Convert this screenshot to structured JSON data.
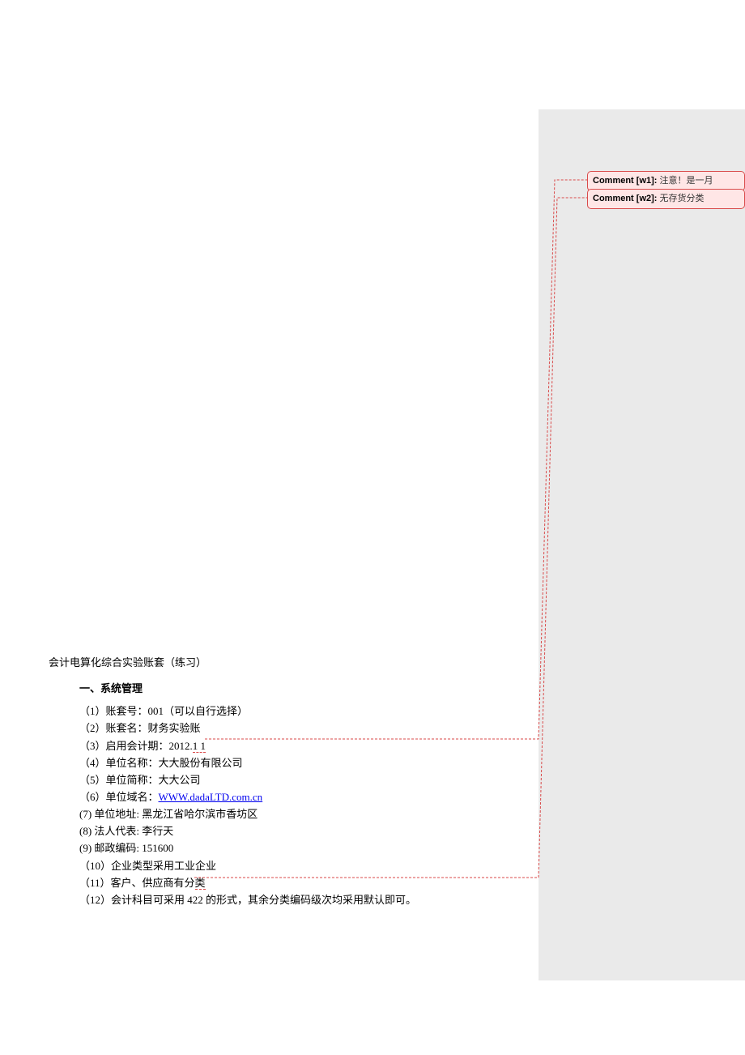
{
  "comments": [
    {
      "label": "Comment [w1]:",
      "text": "注意！是一月"
    },
    {
      "label": "Comment [w2]:",
      "text": "无存货分类"
    }
  ],
  "doc": {
    "title": "会计电算化综合实验账套（练习）",
    "section": "一、系统管理",
    "items": {
      "i1": "（1）账套号：001（可以自行选择）",
      "i2": "（2）账套名：财务实验账",
      "i3_pre": "（3）启用会计期：2012.",
      "i3_hl": "1 1",
      "i4": "（4）单位名称：大大股份有限公司",
      "i5": "（5）单位简称：大大公司",
      "i6_pre": "（6）单位域名：",
      "i6_link": "WWW.dadaLTD.com.cn",
      "i7": "(7)   单位地址: 黑龙江省哈尔滨市香坊区",
      "i8": "(8)   法人代表:  李行天",
      "i9": "(9)   邮政编码: 151600",
      "i10": "（10）企业类型采用工业企业",
      "i11_pre": "（11）客户、供应商有分",
      "i11_hl": "类",
      "i12": "（12）会计科目可采用 422 的形式，其余分类编码级次均采用默认即可。"
    }
  }
}
